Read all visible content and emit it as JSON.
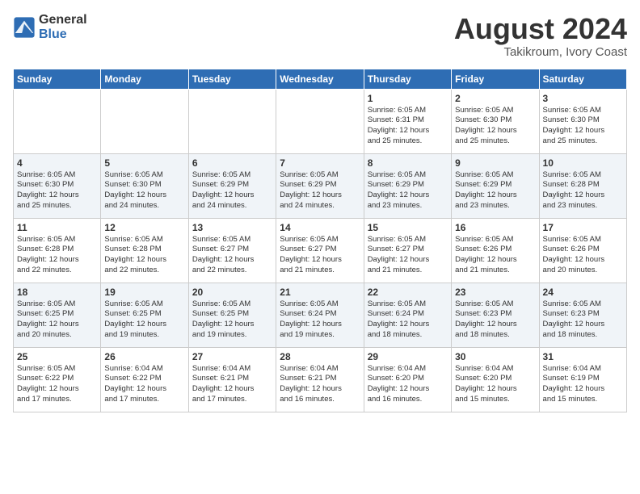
{
  "header": {
    "logo_line1": "General",
    "logo_line2": "Blue",
    "month_title": "August 2024",
    "location": "Takikroum, Ivory Coast"
  },
  "weekdays": [
    "Sunday",
    "Monday",
    "Tuesday",
    "Wednesday",
    "Thursday",
    "Friday",
    "Saturday"
  ],
  "weeks": [
    [
      {
        "day": "",
        "info": ""
      },
      {
        "day": "",
        "info": ""
      },
      {
        "day": "",
        "info": ""
      },
      {
        "day": "",
        "info": ""
      },
      {
        "day": "1",
        "info": "Sunrise: 6:05 AM\nSunset: 6:31 PM\nDaylight: 12 hours\nand 25 minutes."
      },
      {
        "day": "2",
        "info": "Sunrise: 6:05 AM\nSunset: 6:30 PM\nDaylight: 12 hours\nand 25 minutes."
      },
      {
        "day": "3",
        "info": "Sunrise: 6:05 AM\nSunset: 6:30 PM\nDaylight: 12 hours\nand 25 minutes."
      }
    ],
    [
      {
        "day": "4",
        "info": "Sunrise: 6:05 AM\nSunset: 6:30 PM\nDaylight: 12 hours\nand 25 minutes."
      },
      {
        "day": "5",
        "info": "Sunrise: 6:05 AM\nSunset: 6:30 PM\nDaylight: 12 hours\nand 24 minutes."
      },
      {
        "day": "6",
        "info": "Sunrise: 6:05 AM\nSunset: 6:29 PM\nDaylight: 12 hours\nand 24 minutes."
      },
      {
        "day": "7",
        "info": "Sunrise: 6:05 AM\nSunset: 6:29 PM\nDaylight: 12 hours\nand 24 minutes."
      },
      {
        "day": "8",
        "info": "Sunrise: 6:05 AM\nSunset: 6:29 PM\nDaylight: 12 hours\nand 23 minutes."
      },
      {
        "day": "9",
        "info": "Sunrise: 6:05 AM\nSunset: 6:29 PM\nDaylight: 12 hours\nand 23 minutes."
      },
      {
        "day": "10",
        "info": "Sunrise: 6:05 AM\nSunset: 6:28 PM\nDaylight: 12 hours\nand 23 minutes."
      }
    ],
    [
      {
        "day": "11",
        "info": "Sunrise: 6:05 AM\nSunset: 6:28 PM\nDaylight: 12 hours\nand 22 minutes."
      },
      {
        "day": "12",
        "info": "Sunrise: 6:05 AM\nSunset: 6:28 PM\nDaylight: 12 hours\nand 22 minutes."
      },
      {
        "day": "13",
        "info": "Sunrise: 6:05 AM\nSunset: 6:27 PM\nDaylight: 12 hours\nand 22 minutes."
      },
      {
        "day": "14",
        "info": "Sunrise: 6:05 AM\nSunset: 6:27 PM\nDaylight: 12 hours\nand 21 minutes."
      },
      {
        "day": "15",
        "info": "Sunrise: 6:05 AM\nSunset: 6:27 PM\nDaylight: 12 hours\nand 21 minutes."
      },
      {
        "day": "16",
        "info": "Sunrise: 6:05 AM\nSunset: 6:26 PM\nDaylight: 12 hours\nand 21 minutes."
      },
      {
        "day": "17",
        "info": "Sunrise: 6:05 AM\nSunset: 6:26 PM\nDaylight: 12 hours\nand 20 minutes."
      }
    ],
    [
      {
        "day": "18",
        "info": "Sunrise: 6:05 AM\nSunset: 6:25 PM\nDaylight: 12 hours\nand 20 minutes."
      },
      {
        "day": "19",
        "info": "Sunrise: 6:05 AM\nSunset: 6:25 PM\nDaylight: 12 hours\nand 19 minutes."
      },
      {
        "day": "20",
        "info": "Sunrise: 6:05 AM\nSunset: 6:25 PM\nDaylight: 12 hours\nand 19 minutes."
      },
      {
        "day": "21",
        "info": "Sunrise: 6:05 AM\nSunset: 6:24 PM\nDaylight: 12 hours\nand 19 minutes."
      },
      {
        "day": "22",
        "info": "Sunrise: 6:05 AM\nSunset: 6:24 PM\nDaylight: 12 hours\nand 18 minutes."
      },
      {
        "day": "23",
        "info": "Sunrise: 6:05 AM\nSunset: 6:23 PM\nDaylight: 12 hours\nand 18 minutes."
      },
      {
        "day": "24",
        "info": "Sunrise: 6:05 AM\nSunset: 6:23 PM\nDaylight: 12 hours\nand 18 minutes."
      }
    ],
    [
      {
        "day": "25",
        "info": "Sunrise: 6:05 AM\nSunset: 6:22 PM\nDaylight: 12 hours\nand 17 minutes."
      },
      {
        "day": "26",
        "info": "Sunrise: 6:04 AM\nSunset: 6:22 PM\nDaylight: 12 hours\nand 17 minutes."
      },
      {
        "day": "27",
        "info": "Sunrise: 6:04 AM\nSunset: 6:21 PM\nDaylight: 12 hours\nand 17 minutes."
      },
      {
        "day": "28",
        "info": "Sunrise: 6:04 AM\nSunset: 6:21 PM\nDaylight: 12 hours\nand 16 minutes."
      },
      {
        "day": "29",
        "info": "Sunrise: 6:04 AM\nSunset: 6:20 PM\nDaylight: 12 hours\nand 16 minutes."
      },
      {
        "day": "30",
        "info": "Sunrise: 6:04 AM\nSunset: 6:20 PM\nDaylight: 12 hours\nand 15 minutes."
      },
      {
        "day": "31",
        "info": "Sunrise: 6:04 AM\nSunset: 6:19 PM\nDaylight: 12 hours\nand 15 minutes."
      }
    ]
  ]
}
